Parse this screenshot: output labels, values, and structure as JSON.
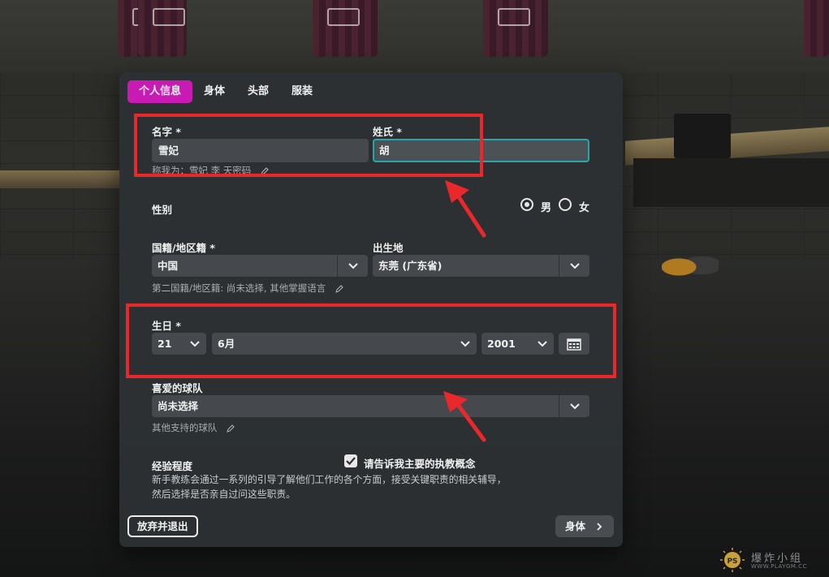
{
  "tabs": [
    {
      "label": "个人信息",
      "active": true
    },
    {
      "label": "身体",
      "active": false
    },
    {
      "label": "头部",
      "active": false
    },
    {
      "label": "服装",
      "active": false
    }
  ],
  "name": {
    "first_label": "名字 *",
    "first_value": "雪妃",
    "last_label": "姓氏 *",
    "last_value": "胡",
    "call_me": "称我为：雪妃 李 天密码"
  },
  "gender": {
    "label": "性别",
    "options": [
      {
        "label": "男",
        "selected": true
      },
      {
        "label": "女",
        "selected": false
      }
    ]
  },
  "nationality": {
    "label": "国籍/地区籍 *",
    "value": "中国",
    "second": "第二国籍/地区籍: 尚未选择, 其他掌握语言"
  },
  "birthplace": {
    "label": "出生地",
    "value": "东莞 (广东省)"
  },
  "birthday": {
    "label": "生日 *",
    "day": "21",
    "month": "6月",
    "year": "2001"
  },
  "team": {
    "label": "喜爱的球队",
    "value": "尚未选择",
    "other": "其他支持的球队"
  },
  "experience": {
    "label": "经验程度",
    "checkbox_label": "请告诉我主要的执教概念",
    "checked": true,
    "description_line1": "新手教练会通过一系列的引导了解他们工作的各个方面，接受关键职责的相关辅导，",
    "description_line2": "然后选择是否亲自过问这些职责。"
  },
  "footer": {
    "quit_label": "放弃并退出",
    "next_label": "身体"
  },
  "watermark": {
    "text": "爆炸小组",
    "url": "WWW.PLAYGM.CC",
    "badge": "PS"
  },
  "colors": {
    "accent": "#c81bb4",
    "focus": "#2aa5ab",
    "annotation": "#e8282a"
  }
}
